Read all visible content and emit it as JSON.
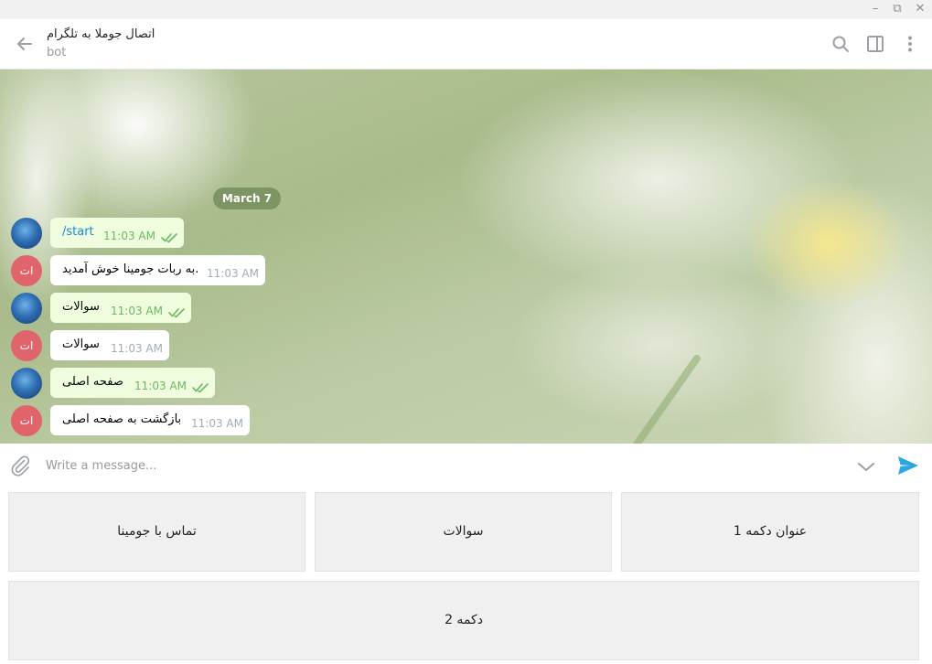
{
  "window": {
    "controls": [
      "minimize",
      "restore",
      "close"
    ]
  },
  "header": {
    "title": "اتصال جوملا به تلگرام",
    "subtitle": "bot",
    "icons": [
      "back-arrow-icon",
      "search-icon",
      "sidebar-toggle-icon",
      "more-vertical-icon"
    ]
  },
  "chat": {
    "date": "March 7",
    "messages": [
      {
        "from": "user",
        "text": "/start",
        "time": "11:03 AM",
        "read": true
      },
      {
        "from": "bot",
        "text": "به ربات جومینا خوش آمدید.",
        "time": "11:03 AM",
        "avatar": "ات"
      },
      {
        "from": "user",
        "text": "سوالات",
        "time": "11:03 AM",
        "read": true
      },
      {
        "from": "bot",
        "text": "سوالات",
        "time": "11:03 AM",
        "avatar": "ات"
      },
      {
        "from": "user",
        "text": "صفحه اصلی",
        "time": "11:03 AM",
        "read": true
      },
      {
        "from": "bot",
        "text": "بازگشت به صفحه اصلی",
        "time": "11:03 AM",
        "avatar": "ات"
      }
    ]
  },
  "composer": {
    "placeholder": "Write a message...",
    "value": ""
  },
  "keyboard": {
    "rows": [
      [
        "تماس با جومینا",
        "سوالات",
        "عنوان دکمه 1"
      ],
      [
        "دکمه 2"
      ]
    ]
  },
  "colors": {
    "accent": "#168acd",
    "outgoing_bubble": "#effdde",
    "incoming_bubble": "#ffffff",
    "read_ticks": "#6cb865",
    "bot_avatar": "#e0646c",
    "date_pill": "#6e8755"
  }
}
